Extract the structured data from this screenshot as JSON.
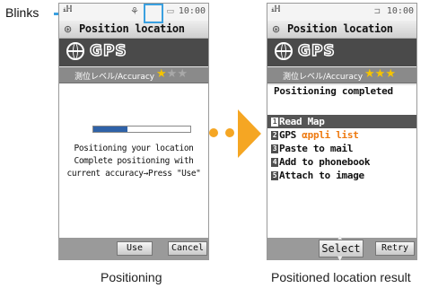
{
  "annotation": {
    "blinks_label": "Blinks"
  },
  "left_screen": {
    "signal": "ᵢℍ",
    "time": "10:00",
    "title": "Position location",
    "gps_logo": "GPS",
    "accuracy_label": "測位レベル/Accuracy",
    "stars_total": 3,
    "stars_filled": 1,
    "progress_fraction": 0.35,
    "messages": [
      "Positioning your location",
      "Complete positioning with",
      "current accuracy→Press \"Use\""
    ],
    "use_button": "Use",
    "cancel_button": "Cancel"
  },
  "right_screen": {
    "signal": "ᵢℍ",
    "time": "10:00",
    "title": "Position location",
    "gps_logo": "GPS",
    "accuracy_label": "測位レベル/Accuracy",
    "stars_total": 3,
    "stars_filled": 3,
    "status": "Positioning completed",
    "menu": [
      {
        "num": "1",
        "label": "Read Map"
      },
      {
        "num": "2",
        "label": "GPS ",
        "appli": "αppli list"
      },
      {
        "num": "3",
        "label": "Paste to mail"
      },
      {
        "num": "4",
        "label": "Add to phonebook"
      },
      {
        "num": "5",
        "label": "Attach to image"
      }
    ],
    "select_button": "Select",
    "retry_button": "Retry"
  },
  "captions": {
    "left": "Positioning",
    "right": "Positioned location result"
  },
  "colors": {
    "blink_highlight": "#3aa0e0",
    "arrow": "#f5a623",
    "selected_row": "#555555",
    "star": "#f5c400"
  }
}
